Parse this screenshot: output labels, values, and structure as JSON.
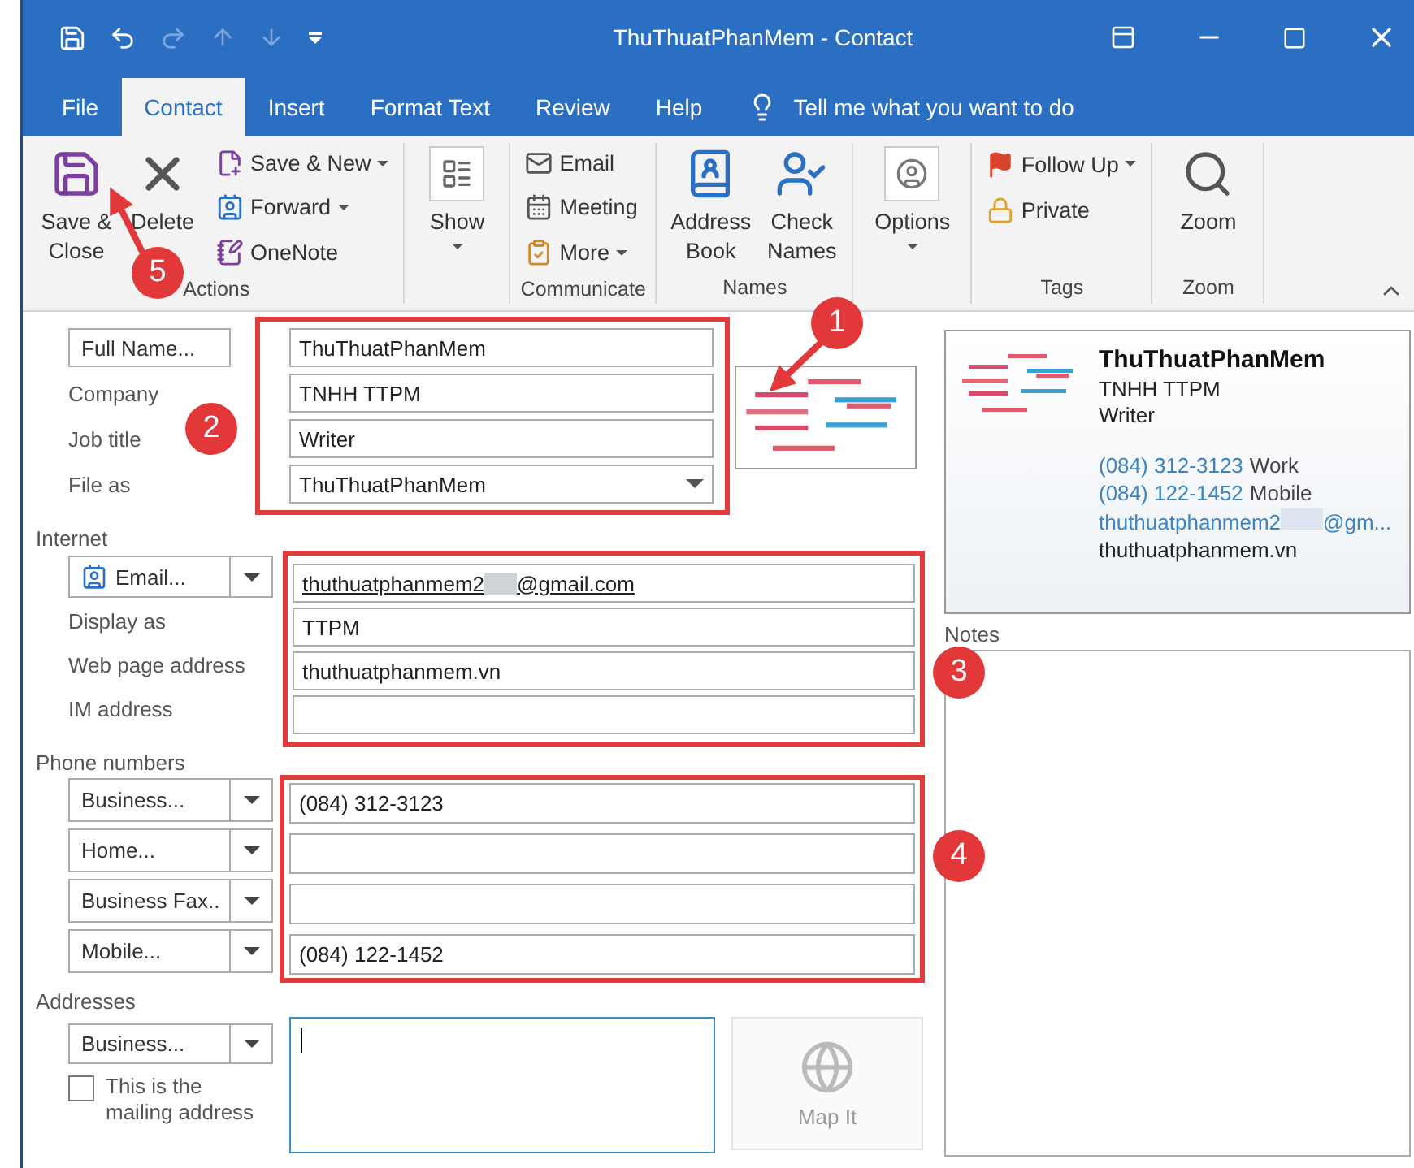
{
  "window": {
    "title": "ThuThuatPhanMem - Contact"
  },
  "quick_access": [
    {
      "kind": "save",
      "disabled": false
    },
    {
      "kind": "undo",
      "disabled": false
    },
    {
      "kind": "redo",
      "disabled": true
    },
    {
      "kind": "up",
      "disabled": true
    },
    {
      "kind": "down",
      "disabled": true
    },
    {
      "kind": "customize",
      "disabled": false
    }
  ],
  "tabs": [
    {
      "label": "File",
      "selected": false
    },
    {
      "label": "Contact",
      "selected": true
    },
    {
      "label": "Insert",
      "selected": false
    },
    {
      "label": "Format Text",
      "selected": false
    },
    {
      "label": "Review",
      "selected": false
    },
    {
      "label": "Help",
      "selected": false
    }
  ],
  "tell_me": "Tell me what you want to do",
  "ribbon": {
    "groups": [
      {
        "label": "Actions",
        "columns": [
          [
            {
              "kind": "save-close",
              "label_lines": [
                "Save &",
                "Close"
              ],
              "large": true
            }
          ],
          [
            {
              "kind": "delete",
              "label_lines": [
                "Delete"
              ],
              "large": true
            }
          ],
          [
            {
              "kind": "save-new",
              "label_lines": [
                "Save & New"
              ],
              "large": false,
              "dropdown": true
            },
            {
              "kind": "forward",
              "label_lines": [
                "Forward"
              ],
              "large": false,
              "dropdown": true
            },
            {
              "kind": "onenote",
              "label_lines": [
                "OneNote"
              ],
              "large": false
            }
          ]
        ]
      },
      {
        "columns": [
          [
            {
              "kind": "show",
              "label_lines": [
                "Show"
              ],
              "large": true,
              "dropdown": true
            }
          ]
        ]
      },
      {
        "label": "Communicate",
        "columns": [
          [
            {
              "kind": "email",
              "label_lines": [
                "Email"
              ],
              "large": false
            },
            {
              "kind": "meeting",
              "label_lines": [
                "Meeting"
              ],
              "large": false
            },
            {
              "kind": "more",
              "label_lines": [
                "More"
              ],
              "large": false,
              "dropdown": true
            }
          ]
        ]
      },
      {
        "label": "Names",
        "columns": [
          [
            {
              "kind": "address-book",
              "label_lines": [
                "Address",
                "Book"
              ],
              "large": true
            }
          ],
          [
            {
              "kind": "check-names",
              "label_lines": [
                "Check",
                "Names"
              ],
              "large": true
            }
          ]
        ]
      },
      {
        "columns": [
          [
            {
              "kind": "options",
              "label_lines": [
                "Options"
              ],
              "large": true,
              "dropdown": true
            }
          ]
        ]
      },
      {
        "label": "Tags",
        "columns": [
          [
            {
              "kind": "follow-up",
              "label_lines": [
                "Follow Up"
              ],
              "large": false,
              "dropdown": true
            },
            {
              "kind": "private",
              "label_lines": [
                "Private"
              ],
              "large": false
            }
          ]
        ]
      },
      {
        "label": "Zoom",
        "columns": [
          [
            {
              "kind": "zoom",
              "label_lines": [
                "Zoom"
              ],
              "large": true
            }
          ]
        ]
      }
    ]
  },
  "name_section": {
    "highlighted": true,
    "rows": [
      {
        "kind": "button",
        "label": "Full Name...",
        "value": "ThuThuatPhanMem"
      },
      {
        "kind": "text",
        "label": "Company",
        "value": "TNHH TTPM"
      },
      {
        "kind": "text",
        "label": "Job title",
        "value": "Writer"
      },
      {
        "kind": "select",
        "label": "File as",
        "value": "ThuThuatPhanMem"
      }
    ]
  },
  "internet": {
    "heading": "Internet",
    "highlighted": true,
    "rows": [
      {
        "kind": "split",
        "label": "Email...",
        "value": "thuthuatphanmem2",
        "redacted": true,
        "value_end": "@gmail.com"
      },
      {
        "kind": "text",
        "label": "Display as",
        "value": "TTPM"
      },
      {
        "kind": "text",
        "label": "Web page address",
        "value": "thuthuatphanmem.vn"
      },
      {
        "kind": "text",
        "label": "IM address"
      }
    ]
  },
  "phone_numbers": {
    "heading": "Phone numbers",
    "highlighted": true,
    "rows": [
      {
        "label": "Business...",
        "value": "(084) 312-3123"
      },
      {
        "label": "Home..."
      },
      {
        "label": "Business Fax.."
      },
      {
        "label": "Mobile...",
        "value": "(084) 122-1452"
      }
    ]
  },
  "addresses": {
    "heading": "Addresses",
    "type_label": "Business...",
    "mailing_checkbox": {
      "label": "This is the mailing address",
      "checked": false
    },
    "map_button": {
      "label": "Map It",
      "disabled": true
    }
  },
  "business_card": {
    "name": "ThuThuatPhanMem",
    "company": "TNHH TTPM",
    "job_title": "Writer",
    "lines": [
      {
        "kind": "phone",
        "number": "(084) 312-3123",
        "type": "Work"
      },
      {
        "kind": "phone",
        "number": "(084) 122-1452",
        "type": "Mobile"
      },
      {
        "kind": "email",
        "value": "thuthuatphanmem2",
        "redacted": true,
        "value_end": "@gm..."
      },
      {
        "kind": "web",
        "value": "thuthuatphanmem.vn"
      }
    ]
  },
  "notes": {
    "label": "Notes"
  },
  "annotations": [
    {
      "number": "1"
    },
    {
      "number": "2"
    },
    {
      "number": "3"
    },
    {
      "number": "4"
    },
    {
      "number": "5"
    }
  ]
}
